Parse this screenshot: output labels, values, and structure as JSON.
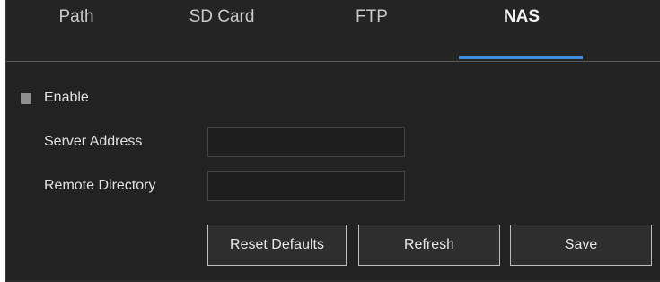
{
  "tabs": [
    {
      "label": "Path",
      "active": false
    },
    {
      "label": "SD Card",
      "active": false
    },
    {
      "label": "FTP",
      "active": false
    },
    {
      "label": "NAS",
      "active": true
    }
  ],
  "enable": {
    "label": "Enable",
    "checked": false
  },
  "fields": {
    "server_address": {
      "label": "Server Address",
      "value": ""
    },
    "remote_directory": {
      "label": "Remote Directory",
      "value": ""
    }
  },
  "buttons": {
    "reset_defaults": "Reset Defaults",
    "refresh": "Refresh",
    "save": "Save"
  },
  "colors": {
    "background": "#222222",
    "active_tab_indicator": "#3d8ee0"
  }
}
